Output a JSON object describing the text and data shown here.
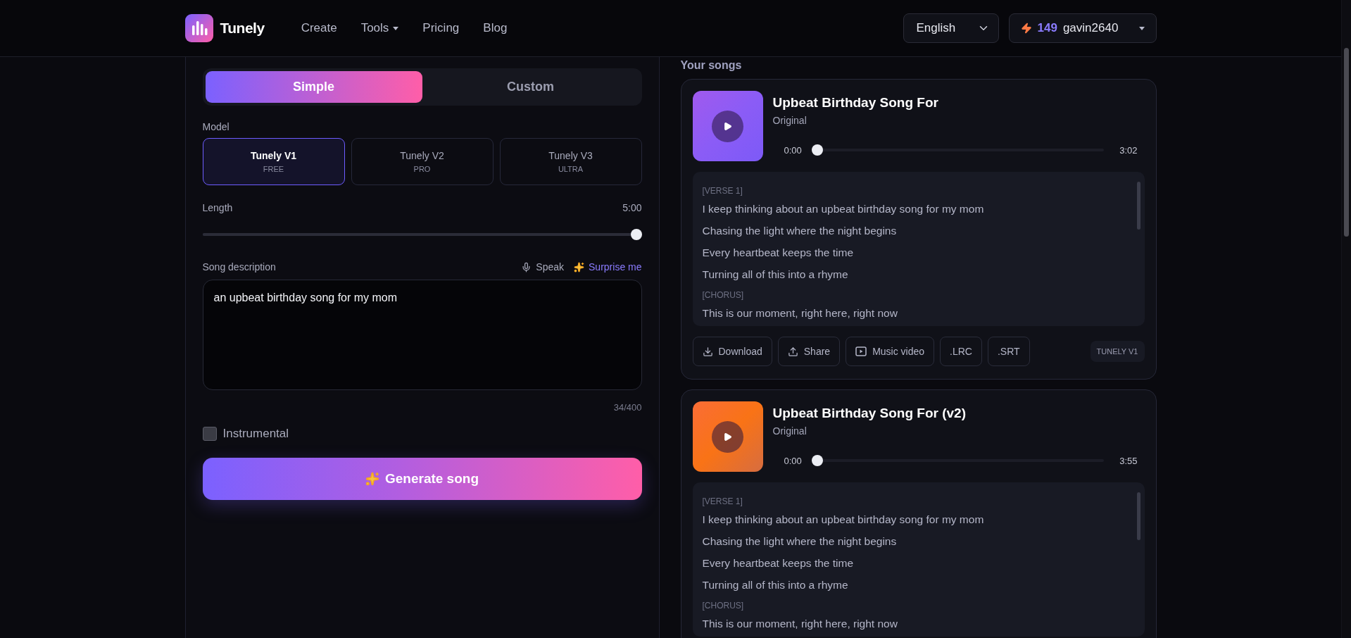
{
  "header": {
    "logo": "Tunely",
    "nav": [
      {
        "label": "Create",
        "dropdown": false
      },
      {
        "label": "Tools",
        "dropdown": true
      },
      {
        "label": "Pricing",
        "dropdown": false
      },
      {
        "label": "Blog",
        "dropdown": false
      }
    ],
    "language": "English",
    "credits": "149",
    "username": "gavin2640"
  },
  "form": {
    "modes": [
      {
        "label": "Simple",
        "selected": true
      },
      {
        "label": "Custom",
        "selected": false
      }
    ],
    "model_label": "Model",
    "models": [
      {
        "name": "Tunely V1",
        "tier": "FREE",
        "selected": true
      },
      {
        "name": "Tunely V2",
        "tier": "PRO",
        "selected": false
      },
      {
        "name": "Tunely V3",
        "tier": "ULTRA",
        "selected": false
      }
    ],
    "length": {
      "label": "Length",
      "value": "5:00",
      "level": 1
    },
    "description": {
      "label": "Song description",
      "speak": "Speak",
      "surprise": "Surprise me",
      "value": "an upbeat birthday song for my mom",
      "counter": "34/400"
    },
    "instrumental": {
      "label": "Instrumental",
      "checked": false
    },
    "generate": "Generate song"
  },
  "songs": {
    "heading": "Your songs",
    "items": [
      {
        "title": "Upbeat Birthday Song For",
        "subtitle": "Original",
        "color": "#8b5cf6",
        "start": "0:00",
        "end": "3:02",
        "level": 0,
        "lyrics": [
          {
            "kind": "section",
            "text": "[VERSE 1]"
          },
          {
            "kind": "line",
            "text": "I keep thinking about an upbeat birthday song for my mom"
          },
          {
            "kind": "line",
            "text": "Chasing the light where the night begins"
          },
          {
            "kind": "line",
            "text": "Every heartbeat keeps the time"
          },
          {
            "kind": "line",
            "text": "Turning all of this into a rhyme"
          },
          {
            "kind": "section",
            "text": "[CHORUS]"
          },
          {
            "kind": "line",
            "text": "This is our moment, right here, right now"
          }
        ],
        "actions": [
          {
            "kind": "download",
            "label": "Download"
          },
          {
            "kind": "share",
            "label": "Share"
          },
          {
            "kind": "video",
            "label": "Music video"
          },
          {
            "kind": "plain",
            "label": ".LRC"
          },
          {
            "kind": "plain",
            "label": ".SRT"
          }
        ],
        "badge": "TUNELY V1"
      },
      {
        "title": "Upbeat Birthday Song For (v2)",
        "subtitle": "Original",
        "color": "#f97316",
        "start": "0:00",
        "end": "3:55",
        "level": 0,
        "lyrics": [
          {
            "kind": "section",
            "text": "[VERSE 1]"
          },
          {
            "kind": "line",
            "text": "I keep thinking about an upbeat birthday song for my mom"
          },
          {
            "kind": "line",
            "text": "Chasing the light where the night begins"
          },
          {
            "kind": "line",
            "text": "Every heartbeat keeps the time"
          },
          {
            "kind": "line",
            "text": "Turning all of this into a rhyme"
          },
          {
            "kind": "section",
            "text": "[CHORUS]"
          },
          {
            "kind": "line",
            "text": "This is our moment, right here, right now"
          }
        ]
      }
    ]
  }
}
